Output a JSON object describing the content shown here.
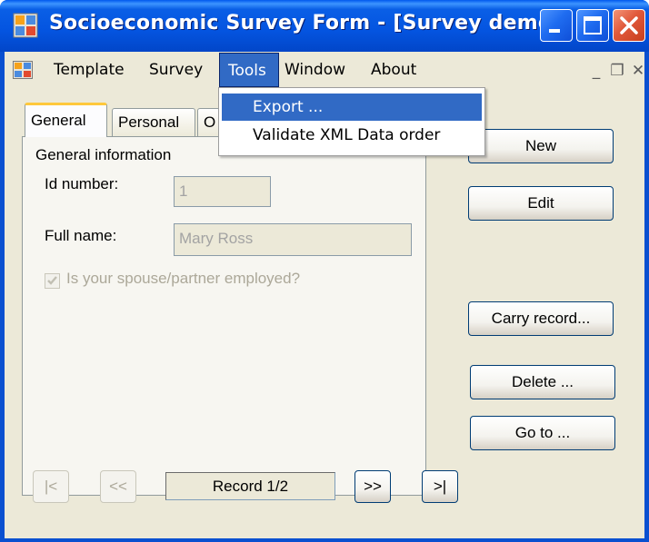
{
  "window": {
    "title": "Socioeconomic Survey Form - [Survey demo]",
    "accent_color": "#0a5fe6",
    "close_color": "#e0583a"
  },
  "menubar": {
    "items": [
      {
        "label": "Template"
      },
      {
        "label": "Survey"
      },
      {
        "label": "Tools"
      },
      {
        "label": "Window"
      },
      {
        "label": "About"
      }
    ],
    "open_menu": "Tools",
    "mdi_controls": {
      "minimize": "_",
      "restore": "❐",
      "close": "✕"
    }
  },
  "tools_menu": {
    "items": [
      {
        "label": "Export ...",
        "highlighted": true
      },
      {
        "label": "Validate XML Data order",
        "highlighted": false
      }
    ]
  },
  "tabs": [
    {
      "label": "General",
      "active": true
    },
    {
      "label": "Personal",
      "active": false
    },
    {
      "label": "O",
      "active": false
    }
  ],
  "general": {
    "group_title": "General information",
    "id_label": "Id number:",
    "id_value": "1",
    "name_label": "Full name:",
    "name_value": "Mary Ross",
    "spouse_checkbox": {
      "label": "Is your spouse/partner employed?",
      "checked": true,
      "enabled": false
    }
  },
  "actions": {
    "new": "New",
    "edit": "Edit",
    "carry": "Carry record...",
    "delete": "Delete ...",
    "goto": "Go to ..."
  },
  "navigation": {
    "first": "|<",
    "prev": "<<",
    "record": "Record 1/2",
    "next": ">>",
    "last": ">|"
  }
}
